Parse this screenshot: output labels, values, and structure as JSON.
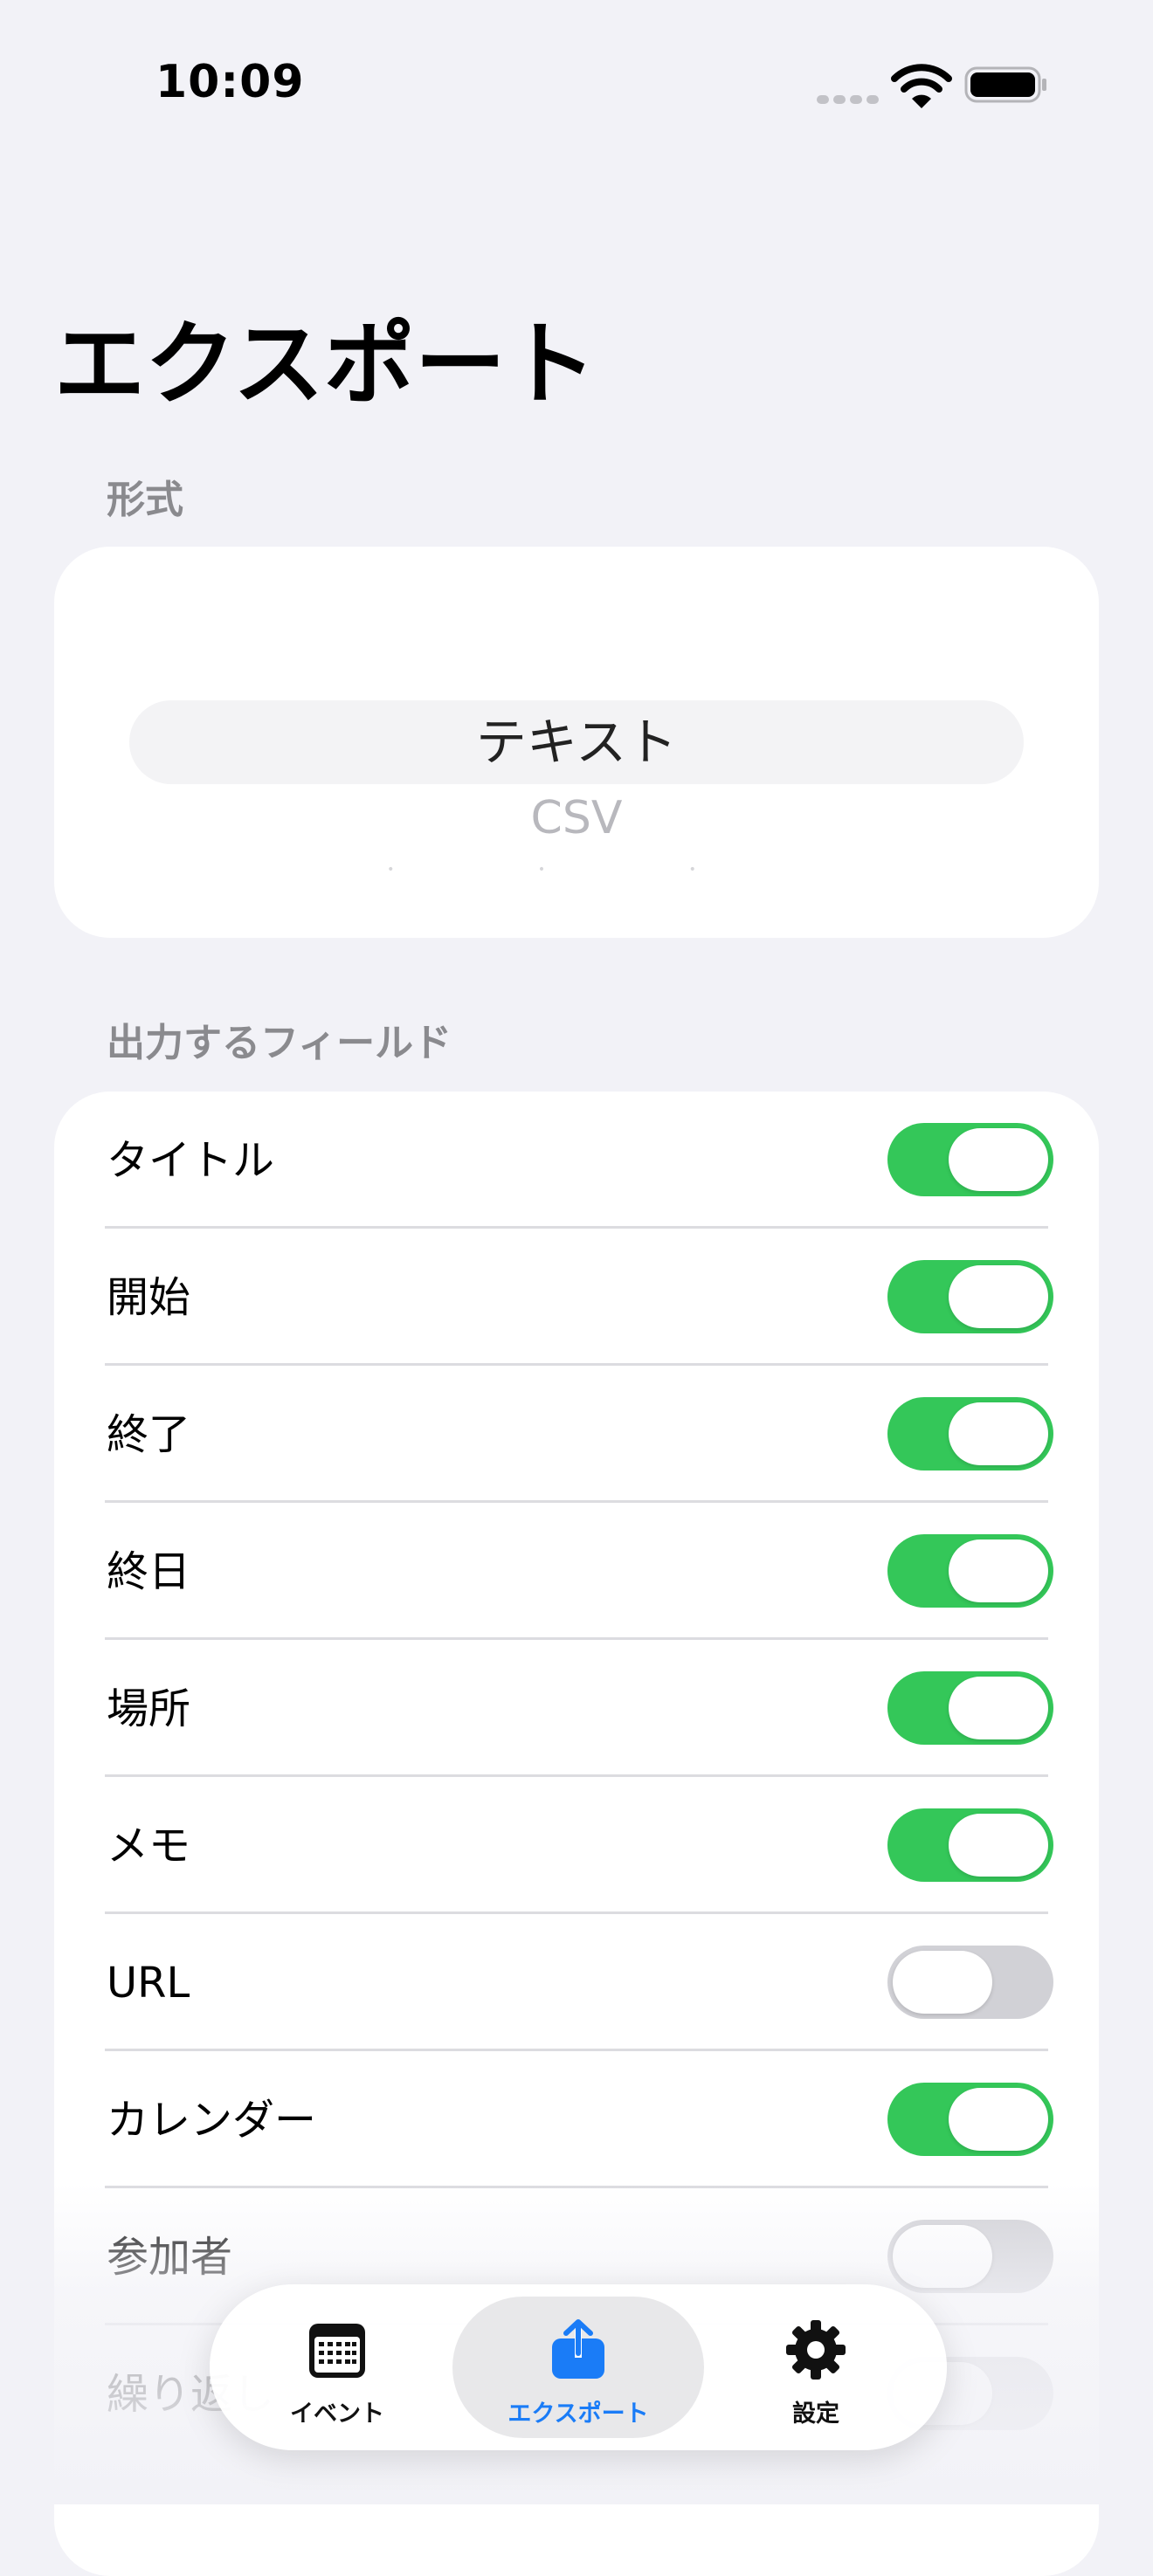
{
  "status_bar": {
    "time": "10:09"
  },
  "title": "エクスポート",
  "format_section": {
    "header": "形式",
    "selected_option": "テキスト",
    "other_option": "CSV"
  },
  "fields_section": {
    "header": "出力するフィールド",
    "rows": [
      {
        "label": "タイトル",
        "enabled": true
      },
      {
        "label": "開始",
        "enabled": true
      },
      {
        "label": "終了",
        "enabled": true
      },
      {
        "label": "終日",
        "enabled": true
      },
      {
        "label": "場所",
        "enabled": true
      },
      {
        "label": "メモ",
        "enabled": true
      },
      {
        "label": "URL",
        "enabled": false
      },
      {
        "label": "カレンダー",
        "enabled": true
      },
      {
        "label": "参加者",
        "enabled": false
      },
      {
        "label": "繰り返し",
        "enabled": false
      }
    ]
  },
  "tab_bar": {
    "tabs": [
      {
        "label": "イベント",
        "icon": "calendar-icon",
        "selected": false
      },
      {
        "label": "エクスポート",
        "icon": "share-icon",
        "selected": true
      },
      {
        "label": "設定",
        "icon": "gear-icon",
        "selected": false
      }
    ]
  },
  "colors": {
    "toggle_on": "#34c759",
    "toggle_off": "#d1d1d6",
    "accent": "#1a7cf7"
  }
}
